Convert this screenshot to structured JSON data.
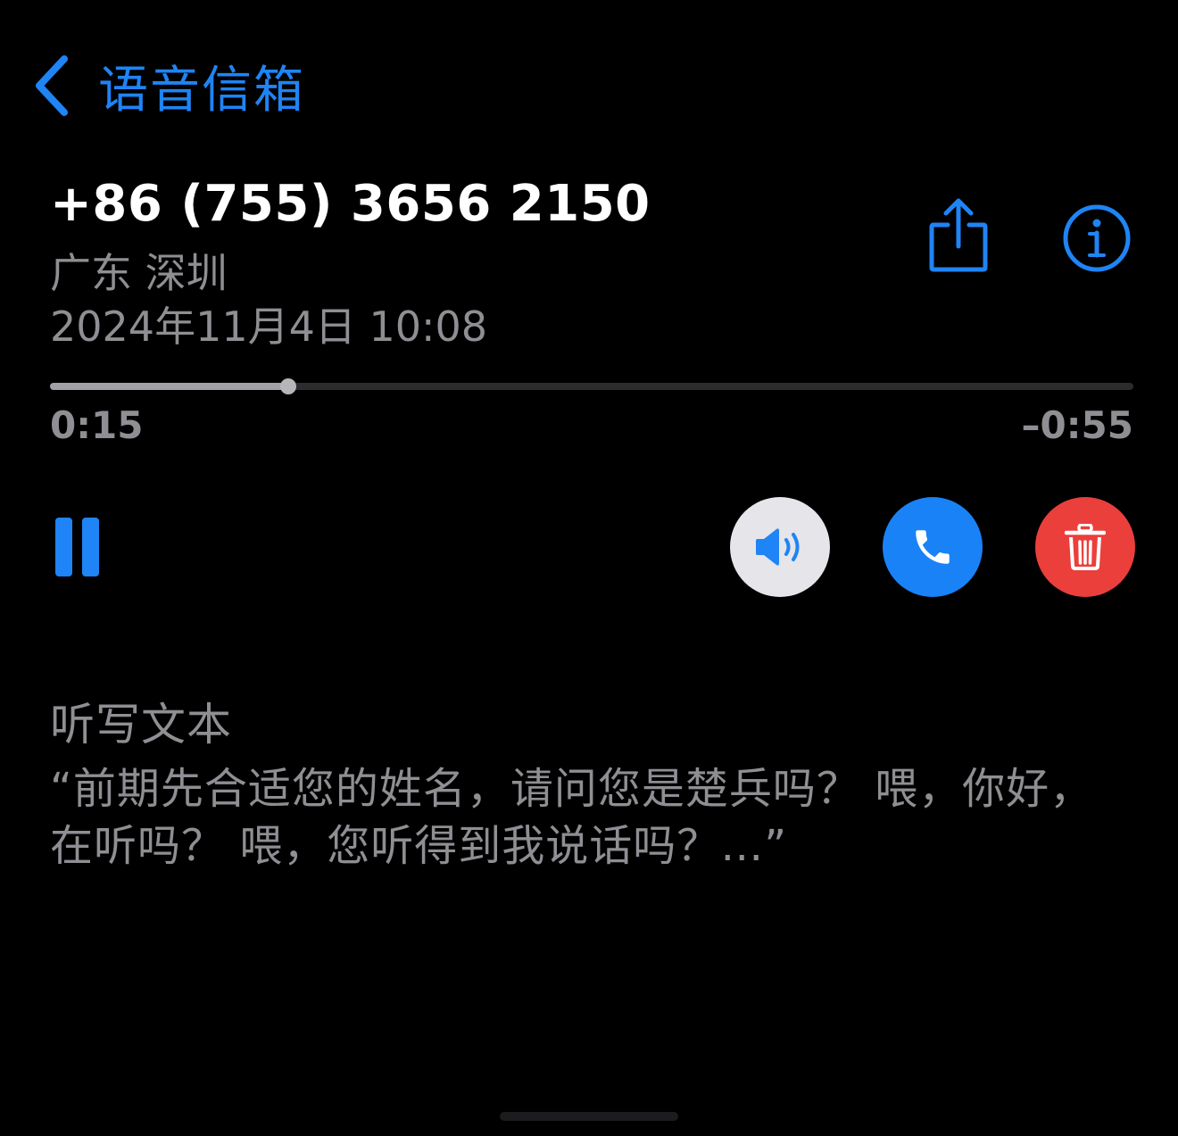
{
  "nav": {
    "back_label": "语音信箱"
  },
  "voicemail": {
    "number": "+86 (755) 3656 2150",
    "location": "广东 深圳",
    "date": "2024年11月4日 10:08"
  },
  "playback": {
    "elapsed": "0:15",
    "remaining": "–0:55",
    "progress_fraction": 0.22,
    "state": "playing"
  },
  "actions": {
    "share_icon": "share-icon",
    "info_icon": "info-icon",
    "pause_icon": "pause-icon",
    "speaker_icon": "speaker-icon",
    "call_icon": "phone-icon",
    "delete_icon": "trash-icon"
  },
  "transcript": {
    "heading": "听写文本",
    "text": "“前期先合适您的姓名，请问您是楚兵吗？ 喂，你好，在听吗？ 喂，您听得到我说话吗？…”"
  },
  "colors": {
    "accent_blue": "#1f84f5",
    "call_blue": "#1a82f7",
    "delete_red": "#eb3f3c",
    "speaker_bg": "#e5e5ea",
    "secondary_text": "#8e8e93",
    "background": "#000000"
  }
}
